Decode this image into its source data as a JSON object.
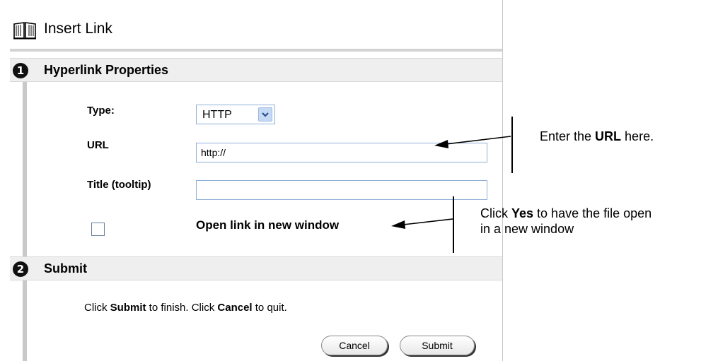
{
  "dialog": {
    "title": "Insert Link",
    "icon": "book-icon"
  },
  "section1": {
    "number": "1",
    "title": "Hyperlink Properties",
    "type_label": "Type:",
    "type_value": "HTTP",
    "type_options": [
      "HTTP"
    ],
    "url_label": "URL",
    "url_value": "http://",
    "title_label": "Title (tooltip)",
    "title_value": "",
    "new_window_label": "Open link in new window",
    "new_window_checked": false
  },
  "section2": {
    "number": "2",
    "title": "Submit",
    "instr_1": "Click ",
    "instr_submit": "Submit",
    "instr_2": " to finish. Click ",
    "instr_cancel": "Cancel",
    "instr_3": " to quit.",
    "cancel_label": "Cancel",
    "submit_label": "Submit"
  },
  "annotations": {
    "url_note_1": "Enter the ",
    "url_note_bold": "URL",
    "url_note_2": " here.",
    "yes_note_1": "Click ",
    "yes_note_bold": "Yes",
    "yes_note_2": " to have the file open",
    "yes_note_3": "in a new window"
  }
}
